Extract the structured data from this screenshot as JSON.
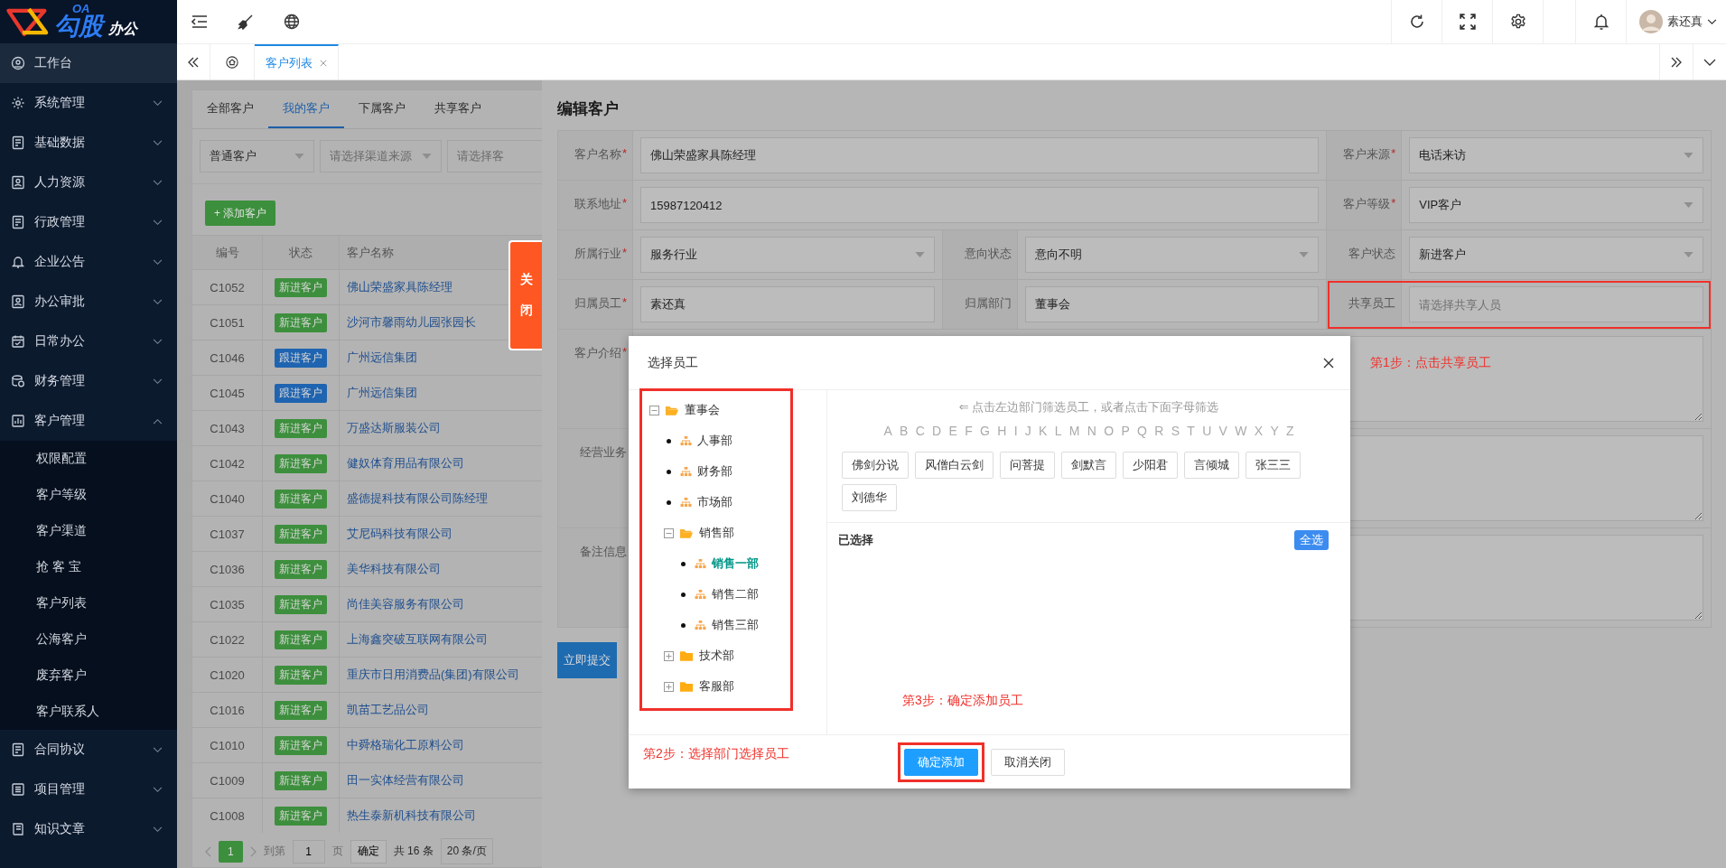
{
  "logo": {
    "badge": "OA",
    "title": "勾股",
    "suffix": "办公"
  },
  "sidebar": {
    "items": [
      {
        "label": "工作台",
        "kind": "link",
        "selected": true
      },
      {
        "label": "系统管理",
        "kind": "group",
        "expanded": false,
        "selected": false
      },
      {
        "label": "基础数据",
        "kind": "group",
        "expanded": false,
        "selected": false
      },
      {
        "label": "人力资源",
        "kind": "group",
        "expanded": false,
        "selected": false
      },
      {
        "label": "行政管理",
        "kind": "group",
        "expanded": false,
        "selected": false
      },
      {
        "label": "企业公告",
        "kind": "group",
        "expanded": false,
        "selected": false
      },
      {
        "label": "办公审批",
        "kind": "group",
        "expanded": false,
        "selected": false
      },
      {
        "label": "日常办公",
        "kind": "group",
        "expanded": false,
        "selected": false
      },
      {
        "label": "财务管理",
        "kind": "group",
        "expanded": false,
        "selected": false
      },
      {
        "label": "客户管理",
        "kind": "group",
        "expanded": true,
        "selected": false,
        "children": [
          {
            "label": "权限配置",
            "selected": false
          },
          {
            "label": "客户等级",
            "selected": false
          },
          {
            "label": "客户渠道",
            "selected": false
          },
          {
            "label": "抢 客 宝",
            "selected": false
          },
          {
            "label": "客户列表",
            "selected": false
          },
          {
            "label": "公海客户",
            "selected": false
          },
          {
            "label": "废弃客户",
            "selected": false
          },
          {
            "label": "客户联系人",
            "selected": false
          }
        ]
      },
      {
        "label": "合同协议",
        "kind": "group",
        "expanded": false,
        "selected": false
      },
      {
        "label": "项目管理",
        "kind": "group",
        "expanded": false,
        "selected": false
      },
      {
        "label": "知识文章",
        "kind": "group",
        "expanded": false,
        "selected": false
      }
    ]
  },
  "header": {
    "user_name": "素还真"
  },
  "page_tabs": [
    {
      "label": "客户列表",
      "selected": true
    }
  ],
  "customer_list": {
    "tabs": [
      {
        "label": "全部客户",
        "selected": false
      },
      {
        "label": "我的客户",
        "selected": true
      },
      {
        "label": "下属客户",
        "selected": false
      },
      {
        "label": "共享客户",
        "selected": false
      }
    ],
    "filters": [
      {
        "value": "普通客户"
      },
      {
        "placeholder": "请选择渠道来源"
      },
      {
        "placeholder": "请选择客"
      }
    ],
    "add_button": "+ 添加客户",
    "columns": [
      "编号",
      "状态",
      "客户名称"
    ],
    "rows": [
      {
        "id": "C1052",
        "status": "新进客户",
        "color": "#3d8f3d",
        "name": "佛山荣盛家具陈经理"
      },
      {
        "id": "C1051",
        "status": "新进客户",
        "color": "#3d8f3d",
        "name": "沙河市馨雨幼儿园张园长"
      },
      {
        "id": "C1046",
        "status": "跟进客户",
        "color": "#1f64b0",
        "name": "广州远信集团"
      },
      {
        "id": "C1045",
        "status": "跟进客户",
        "color": "#1f64b0",
        "name": "广州远信集团"
      },
      {
        "id": "C1043",
        "status": "新进客户",
        "color": "#3d8f3d",
        "name": "万盛达斯服装公司"
      },
      {
        "id": "C1042",
        "status": "新进客户",
        "color": "#3d8f3d",
        "name": "健奴体育用品有限公司"
      },
      {
        "id": "C1040",
        "status": "新进客户",
        "color": "#3d8f3d",
        "name": "盛德提科技有限公司陈经理"
      },
      {
        "id": "C1037",
        "status": "新进客户",
        "color": "#3d8f3d",
        "name": "艾尼码科技有限公司"
      },
      {
        "id": "C1036",
        "status": "新进客户",
        "color": "#3d8f3d",
        "name": "美华科技有限公司"
      },
      {
        "id": "C1035",
        "status": "新进客户",
        "color": "#3d8f3d",
        "name": "尚佳美容服务有限公司"
      },
      {
        "id": "C1022",
        "status": "新进客户",
        "color": "#3d8f3d",
        "name": "上海鑫突破互联网有限公司"
      },
      {
        "id": "C1020",
        "status": "新进客户",
        "color": "#3d8f3d",
        "name": "重庆市日用消费品(集团)有限公司"
      },
      {
        "id": "C1016",
        "status": "新进客户",
        "color": "#3d8f3d",
        "name": "凯苗工艺品公司"
      },
      {
        "id": "C1010",
        "status": "新进客户",
        "color": "#3d8f3d",
        "name": "中舜格瑞化工原料公司"
      },
      {
        "id": "C1009",
        "status": "新进客户",
        "color": "#3d8f3d",
        "name": "田一实体经营有限公司"
      },
      {
        "id": "C1008",
        "status": "新进客户",
        "color": "#3d8f3d",
        "name": "热生泰新机科技有限公司"
      }
    ],
    "pagination": {
      "current": "1",
      "goto_label": "到第",
      "goto_value": "1",
      "page_unit": "页",
      "confirm": "确定",
      "total": "共 16 条",
      "page_size": "20 条/页"
    }
  },
  "close_tab": "关闭",
  "form": {
    "title": "编辑客户",
    "rows": [
      {
        "fields": [
          {
            "label": "客户名称",
            "required": true,
            "kind": "input",
            "value": "佛山荣盛家具陈经理"
          },
          {
            "label": "客户来源",
            "required": true,
            "kind": "select",
            "value": "电话来访"
          }
        ]
      },
      {
        "fields": [
          {
            "label": "联系地址",
            "required": true,
            "kind": "input",
            "value": "15987120412"
          },
          {
            "label": "客户等级",
            "required": true,
            "kind": "select",
            "value": "VIP客户"
          }
        ]
      },
      {
        "fields": [
          {
            "label": "所属行业",
            "required": true,
            "kind": "select",
            "value": "服务行业"
          },
          {
            "label": "意向状态",
            "required": false,
            "kind": "select",
            "value": "意向不明"
          },
          {
            "label": "客户状态",
            "required": false,
            "kind": "select",
            "value": "新进客户"
          }
        ]
      },
      {
        "fields": [
          {
            "label": "归属员工",
            "required": true,
            "kind": "input",
            "value": "素还真"
          },
          {
            "label": "归属部门",
            "required": false,
            "kind": "input",
            "value": "董事会"
          },
          {
            "label": "共享员工",
            "required": false,
            "kind": "input",
            "placeholder": "请选择共享人员",
            "highlighted": true
          }
        ]
      },
      {
        "fields": [
          {
            "label": "客户介绍",
            "required": true,
            "kind": "textarea"
          }
        ]
      },
      {
        "fields": [
          {
            "label": "经营业务",
            "required": false,
            "kind": "textarea"
          }
        ]
      },
      {
        "fields": [
          {
            "label": "备注信息",
            "required": false,
            "kind": "textarea"
          }
        ]
      }
    ],
    "submit": "立即提交",
    "required_mark": "*"
  },
  "dialog": {
    "title": "选择员工",
    "tree": {
      "highlighted": true,
      "nodes": [
        {
          "label": "董事会",
          "kind": "folder",
          "expanded": true,
          "selected": false,
          "children": [
            {
              "label": "人事部",
              "kind": "leaf",
              "selected": false
            },
            {
              "label": "财务部",
              "kind": "leaf",
              "selected": false
            },
            {
              "label": "市场部",
              "kind": "leaf",
              "selected": false
            },
            {
              "label": "销售部",
              "kind": "folder",
              "expanded": true,
              "selected": false,
              "children": [
                {
                  "label": "销售一部",
                  "kind": "leaf",
                  "selected": true
                },
                {
                  "label": "销售二部",
                  "kind": "leaf",
                  "selected": false
                },
                {
                  "label": "销售三部",
                  "kind": "leaf",
                  "selected": false
                }
              ]
            },
            {
              "label": "技术部",
              "kind": "folder",
              "expanded": false,
              "selected": false
            },
            {
              "label": "客服部",
              "kind": "folder",
              "expanded": false,
              "selected": false
            }
          ]
        }
      ]
    },
    "hint": "⇐ 点击左边部门筛选员工，或者点击下面字母筛选",
    "letters": [
      "A",
      "B",
      "C",
      "D",
      "E",
      "F",
      "G",
      "H",
      "I",
      "J",
      "K",
      "L",
      "M",
      "N",
      "O",
      "P",
      "Q",
      "R",
      "S",
      "T",
      "U",
      "V",
      "W",
      "X",
      "Y",
      "Z"
    ],
    "employees": [
      "佛剑分说",
      "风僧白云剑",
      "问菩提",
      "剑默言",
      "少阳君",
      "言倾城",
      "张三三",
      "刘德华"
    ],
    "selected_label": "已选择",
    "select_all": "全选",
    "buttons": [
      {
        "label": "确定添加",
        "kind": "primary",
        "highlighted": true
      },
      {
        "label": "取消关闭",
        "kind": "default",
        "highlighted": false
      }
    ]
  },
  "annotations": [
    {
      "text": "第1步：点击共享员工"
    },
    {
      "text": "第2步：选择部门选择员工"
    },
    {
      "text": "第3步：确定添加员工"
    }
  ]
}
